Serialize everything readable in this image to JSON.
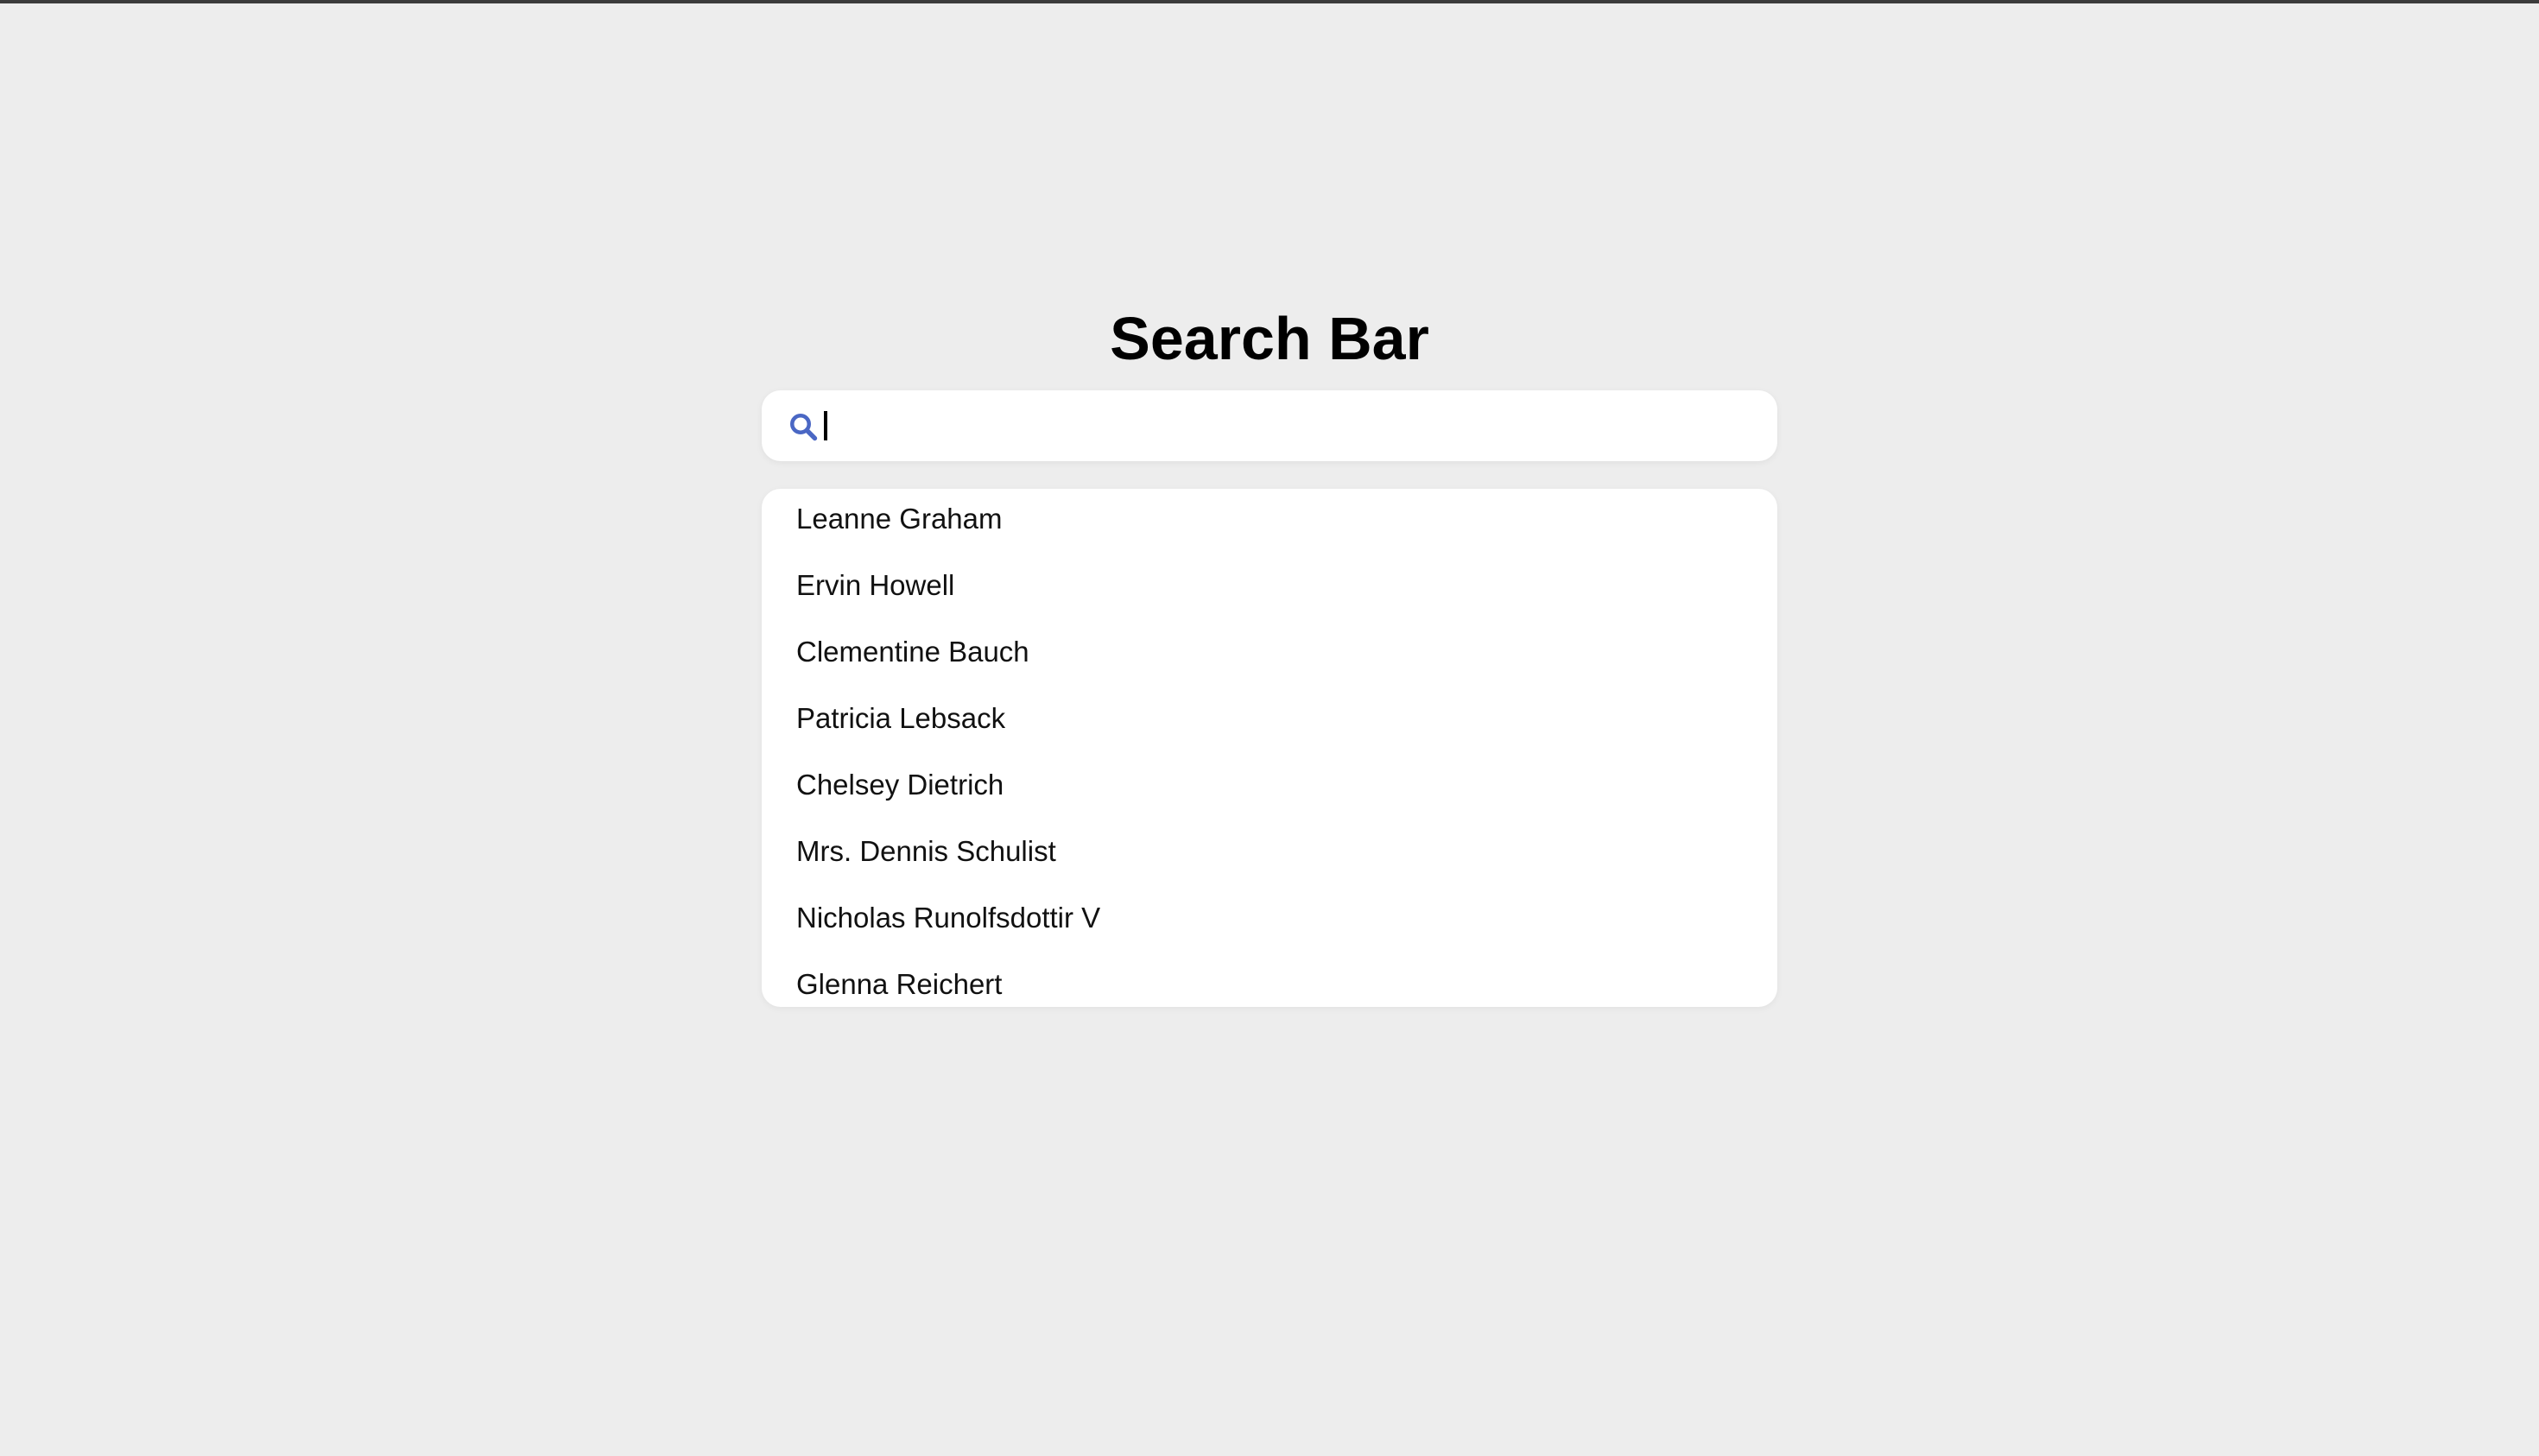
{
  "page": {
    "title": "Search Bar"
  },
  "search": {
    "icon": "search-icon",
    "value": "",
    "placeholder": "",
    "icon_color": "#4a67c4"
  },
  "results": {
    "items": [
      "Leanne Graham",
      "Ervin Howell",
      "Clementine Bauch",
      "Patricia Lebsack",
      "Chelsey Dietrich",
      "Mrs. Dennis Schulist",
      "Nicholas Runolfsdottir V",
      "Glenna Reichert"
    ]
  }
}
